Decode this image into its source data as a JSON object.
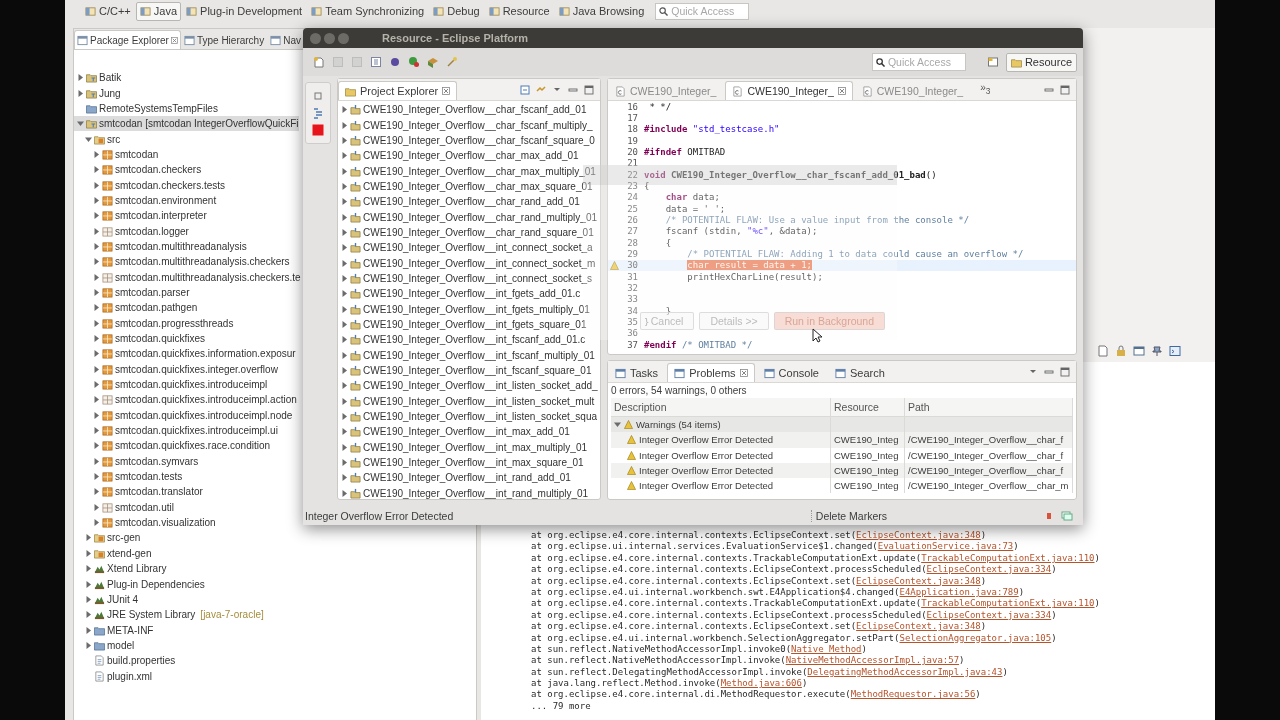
{
  "perspective_bar": {
    "perspectives": [
      {
        "label": "C/C++",
        "selected": false
      },
      {
        "label": "Java",
        "selected": true
      },
      {
        "label": "Plug-in Development",
        "selected": false
      },
      {
        "label": "Team Synchronizing",
        "selected": false
      },
      {
        "label": "Debug",
        "selected": false
      },
      {
        "label": "Resource",
        "selected": false
      },
      {
        "label": "Java Browsing",
        "selected": false
      }
    ],
    "quick_access": {
      "placeholder": "Quick Access"
    }
  },
  "package_explorer": {
    "tabs": [
      {
        "label": "Package Explorer",
        "selected": true
      },
      {
        "label": "Type Hierarchy",
        "selected": false
      },
      {
        "label": "Nav",
        "selected": false
      }
    ],
    "tree": [
      {
        "label": "Batik",
        "kind": "project",
        "expanded": false,
        "selected": false
      },
      {
        "label": "Jung",
        "kind": "project",
        "expanded": false,
        "selected": false
      },
      {
        "label": "RemoteSystemsTempFiles",
        "kind": "folder",
        "selected": false
      },
      {
        "label": "smtcodan [smtcodan IntegerOverflowQuickFi",
        "kind": "project",
        "expanded": true,
        "selected": true,
        "children": [
          {
            "label": "src",
            "kind": "source-folder",
            "expanded": true,
            "selected": false,
            "children": [
              {
                "label": "smtcodan",
                "kind": "package",
                "expanded": false,
                "selected": false
              },
              {
                "label": "smtcodan.checkers",
                "kind": "package",
                "expanded": false,
                "selected": false
              },
              {
                "label": "smtcodan.checkers.tests",
                "kind": "package",
                "expanded": false,
                "selected": false
              },
              {
                "label": "smtcodan.environment",
                "kind": "package",
                "expanded": false,
                "selected": false
              },
              {
                "label": "smtcodan.interpreter",
                "kind": "package",
                "expanded": false,
                "selected": false
              },
              {
                "label": "smtcodan.logger",
                "kind": "empty-package",
                "expanded": false,
                "selected": false
              },
              {
                "label": "smtcodan.multithreadanalysis",
                "kind": "package",
                "expanded": false,
                "selected": false
              },
              {
                "label": "smtcodan.multithreadanalysis.checkers",
                "kind": "package",
                "expanded": false,
                "selected": false
              },
              {
                "label": "smtcodan.multithreadanalysis.checkers.te",
                "kind": "empty-package",
                "expanded": false,
                "selected": false
              },
              {
                "label": "smtcodan.parser",
                "kind": "package",
                "expanded": false,
                "selected": false
              },
              {
                "label": "smtcodan.pathgen",
                "kind": "package",
                "expanded": false,
                "selected": false
              },
              {
                "label": "smtcodan.progressthreads",
                "kind": "package",
                "expanded": false,
                "selected": false
              },
              {
                "label": "smtcodan.quickfixes",
                "kind": "package",
                "expanded": false,
                "selected": false
              },
              {
                "label": "smtcodan.quickfixes.information.exposur",
                "kind": "package",
                "expanded": false,
                "selected": false
              },
              {
                "label": "smtcodan.quickfixes.integer.overflow",
                "kind": "package",
                "expanded": false,
                "selected": false
              },
              {
                "label": "smtcodan.quickfixes.introduceimpl",
                "kind": "package",
                "expanded": false,
                "selected": false
              },
              {
                "label": "smtcodan.quickfixes.introduceimpl.action",
                "kind": "empty-package",
                "expanded": false,
                "selected": false
              },
              {
                "label": "smtcodan.quickfixes.introduceimpl.node",
                "kind": "package",
                "expanded": false,
                "selected": false
              },
              {
                "label": "smtcodan.quickfixes.introduceimpl.ui",
                "kind": "package",
                "expanded": false,
                "selected": false
              },
              {
                "label": "smtcodan.quickfixes.race.condition",
                "kind": "package",
                "expanded": false,
                "selected": false
              },
              {
                "label": "smtcodan.symvars",
                "kind": "package",
                "expanded": false,
                "selected": false
              },
              {
                "label": "smtcodan.tests",
                "kind": "package",
                "expanded": false,
                "selected": false
              },
              {
                "label": "smtcodan.translator",
                "kind": "package",
                "expanded": false,
                "selected": false
              },
              {
                "label": "smtcodan.util",
                "kind": "empty-package",
                "expanded": false,
                "selected": false
              },
              {
                "label": "smtcodan.visualization",
                "kind": "package",
                "expanded": false,
                "selected": false
              }
            ]
          },
          {
            "label": "src-gen",
            "kind": "source-folder",
            "expanded": false,
            "selected": false
          },
          {
            "label": "xtend-gen",
            "kind": "source-folder",
            "expanded": false,
            "selected": false
          },
          {
            "label": "Xtend Library",
            "kind": "library",
            "expanded": false,
            "selected": false
          },
          {
            "label": "Plug-in Dependencies",
            "kind": "library",
            "expanded": false,
            "selected": false
          },
          {
            "label": "JUnit 4",
            "kind": "library",
            "expanded": false,
            "selected": false
          },
          {
            "label": "JRE System Library",
            "decoration": "[java-7-oracle]",
            "kind": "library",
            "expanded": false,
            "selected": false
          },
          {
            "label": "META-INF",
            "kind": "folder",
            "expanded": false,
            "selected": false
          },
          {
            "label": "model",
            "kind": "folder",
            "expanded": false,
            "selected": false
          },
          {
            "label": "build.properties",
            "kind": "file",
            "selected": false
          },
          {
            "label": "plugin.xml",
            "kind": "file",
            "selected": false
          }
        ]
      }
    ]
  },
  "console": {
    "lines": [
      {
        "text": "at org.eclipse.e4.core.internal.contexts.EclipseContext.set(",
        "link": "EclipseContext.java:348",
        "end": ")"
      },
      {
        "text": "at org.eclipse.ui.internal.services.EvaluationService$1.changed(",
        "link": "EvaluationService.java:73",
        "end": ")"
      },
      {
        "text": "at org.eclipse.e4.core.internal.contexts.TrackableComputationExt.update(",
        "link": "TrackableComputationExt.java:110",
        "end": ")"
      },
      {
        "text": "at org.eclipse.e4.core.internal.contexts.EclipseContext.processScheduled(",
        "link": "EclipseContext.java:334",
        "end": ")"
      },
      {
        "text": "at org.eclipse.e4.core.internal.contexts.EclipseContext.set(",
        "link": "EclipseContext.java:348",
        "end": ")"
      },
      {
        "text": "at org.eclipse.e4.ui.internal.workbench.swt.E4Application$4.changed(",
        "link": "E4Application.java:789",
        "end": ")"
      },
      {
        "text": "at org.eclipse.e4.core.internal.contexts.TrackableComputationExt.update(",
        "link": "TrackableComputationExt.java:110",
        "end": ")"
      },
      {
        "text": "at org.eclipse.e4.core.internal.contexts.EclipseContext.processScheduled(",
        "link": "EclipseContext.java:334",
        "end": ")"
      },
      {
        "text": "at org.eclipse.e4.core.internal.contexts.EclipseContext.set(",
        "link": "EclipseContext.java:348",
        "end": ")"
      },
      {
        "text": "at org.eclipse.e4.ui.internal.workbench.SelectionAggregator.setPart(",
        "link": "SelectionAggregator.java:105",
        "end": ")"
      },
      {
        "text": "at sun.reflect.NativeMethodAccessorImpl.invoke0(",
        "link": "Native Method",
        "end": ")"
      },
      {
        "text": "at sun.reflect.NativeMethodAccessorImpl.invoke(",
        "link": "NativeMethodAccessorImpl.java:57",
        "end": ")"
      },
      {
        "text": "at sun.reflect.DelegatingMethodAccessorImpl.invoke(",
        "link": "DelegatingMethodAccessorImpl.java:43",
        "end": ")"
      },
      {
        "text": "at java.lang.reflect.Method.invoke(",
        "link": "Method.java:606",
        "end": ")"
      },
      {
        "text": "at org.eclipse.e4.core.internal.di.MethodRequestor.execute(",
        "link": "MethodRequestor.java:56",
        "end": ")"
      },
      {
        "text": "... 79 more"
      }
    ]
  },
  "window": {
    "title": "Resource - Eclipse Platform",
    "quick_access": {
      "placeholder": "Quick Access"
    },
    "perspective": {
      "label": "Resource",
      "selected": true
    },
    "project_explorer": {
      "title": "Project Explorer",
      "items": [
        {
          "label": "CWE190_Integer_Overflow__char_fscanf_add_01",
          "selected": false
        },
        {
          "label": "CWE190_Integer_Overflow__char_fscanf_multiply_",
          "selected": false
        },
        {
          "label": "CWE190_Integer_Overflow__char_fscanf_square_0",
          "selected": false
        },
        {
          "label": "CWE190_Integer_Overflow__char_max_add_01",
          "selected": false
        },
        {
          "label": "CWE190_Integer_Overflow__char_max_multiply_01",
          "selected": false
        },
        {
          "label": "CWE190_Integer_Overflow__char_max_square_01",
          "selected": false
        },
        {
          "label": "CWE190_Integer_Overflow__char_rand_add_01",
          "selected": false
        },
        {
          "label": "CWE190_Integer_Overflow__char_rand_multiply_01",
          "selected": false
        },
        {
          "label": "CWE190_Integer_Overflow__char_rand_square_01",
          "selected": false
        },
        {
          "label": "CWE190_Integer_Overflow__int_connect_socket_a",
          "selected": false
        },
        {
          "label": "CWE190_Integer_Overflow__int_connect_socket_m",
          "selected": false
        },
        {
          "label": "CWE190_Integer_Overflow__int_connect_socket_s",
          "selected": false
        },
        {
          "label": "CWE190_Integer_Overflow__int_fgets_add_01.c",
          "selected": false
        },
        {
          "label": "CWE190_Integer_Overflow__int_fgets_multiply_01",
          "selected": false
        },
        {
          "label": "CWE190_Integer_Overflow__int_fgets_square_01",
          "selected": false
        },
        {
          "label": "CWE190_Integer_Overflow__int_fscanf_add_01.c",
          "selected": false
        },
        {
          "label": "CWE190_Integer_Overflow__int_fscanf_multiply_01",
          "selected": false
        },
        {
          "label": "CWE190_Integer_Overflow__int_fscanf_square_01",
          "selected": false
        },
        {
          "label": "CWE190_Integer_Overflow__int_listen_socket_add_",
          "selected": false
        },
        {
          "label": "CWE190_Integer_Overflow__int_listen_socket_mult",
          "selected": false
        },
        {
          "label": "CWE190_Integer_Overflow__int_listen_socket_squa",
          "selected": false
        },
        {
          "label": "CWE190_Integer_Overflow__int_max_add_01",
          "selected": false
        },
        {
          "label": "CWE190_Integer_Overflow__int_max_multiply_01",
          "selected": false
        },
        {
          "label": "CWE190_Integer_Overflow__int_max_square_01",
          "selected": false
        },
        {
          "label": "CWE190_Integer_Overflow__int_rand_add_01",
          "selected": false
        },
        {
          "label": "CWE190_Integer_Overflow__int_rand_multiply_01",
          "selected": false
        }
      ]
    },
    "editor": {
      "tabs": [
        {
          "label": "CWE190_Integer_",
          "selected": false
        },
        {
          "label": "CWE190_Integer_",
          "selected": true
        },
        {
          "label": "CWE190_Integer_",
          "selected": false
        }
      ],
      "more_tabs": "»$_{3}$",
      "lines": [
        {
          "number": "16",
          "segments": [
            {
              "kind": "plain",
              "text": " * */"
            }
          ]
        },
        {
          "number": "17"
        },
        {
          "number": "18",
          "segments": [
            {
              "kind": "keyword",
              "text": "#include"
            },
            {
              "kind": "string",
              "text": " \"std_testcase.h\""
            }
          ]
        },
        {
          "number": "19"
        },
        {
          "number": "20",
          "segments": [
            {
              "kind": "keyword",
              "text": "#ifndef"
            },
            {
              "kind": "plain",
              "text": " OMITBAD"
            }
          ]
        },
        {
          "number": "21"
        },
        {
          "number": "22",
          "segments": [
            {
              "kind": "keyword",
              "text": "void"
            },
            {
              "kind": "function",
              "text": " CWE190_Integer_Overflow__char_fscanf_add_01_bad"
            },
            {
              "kind": "plain",
              "text": "()"
            }
          ]
        },
        {
          "number": "23",
          "segments": [
            {
              "kind": "plain",
              "text": "{"
            }
          ]
        },
        {
          "number": "24",
          "segments": [
            {
              "kind": "keyword",
              "text": "    char"
            },
            {
              "kind": "plain",
              "text": " data;"
            }
          ]
        },
        {
          "number": "25",
          "segments": [
            {
              "kind": "plain",
              "text": "    data = ' ';"
            }
          ]
        },
        {
          "number": "26",
          "segments": [
            {
              "kind": "comment",
              "text": "    /* POTENTIAL FLAW: Use a value input from the console */"
            }
          ]
        },
        {
          "number": "27",
          "segments": [
            {
              "kind": "plain",
              "text": "    fscanf (stdin, "
            },
            {
              "kind": "string",
              "text": "\"%c\""
            },
            {
              "kind": "plain",
              "text": ", &data);"
            }
          ]
        },
        {
          "number": "28",
          "segments": [
            {
              "kind": "plain",
              "text": "    {"
            }
          ]
        },
        {
          "number": "29",
          "segments": [
            {
              "kind": "comment",
              "text": "        /* POTENTIAL FLAW: Adding 1 to data could cause an overflow */"
            }
          ]
        },
        {
          "number": "30",
          "warning": true,
          "current": true,
          "segments": [
            {
              "kind": "highlight",
              "text": "        char result = data + 1;"
            }
          ]
        },
        {
          "number": "31",
          "segments": [
            {
              "kind": "plain",
              "text": "        printHexCharLine(result);"
            }
          ]
        },
        {
          "number": "32"
        },
        {
          "number": "33"
        },
        {
          "number": "34",
          "segments": [
            {
              "kind": "plain",
              "text": "    }"
            }
          ]
        },
        {
          "number": "35",
          "segments": [
            {
              "kind": "plain",
              "text": "}"
            }
          ]
        },
        {
          "number": "36"
        },
        {
          "number": "37",
          "segments": [
            {
              "kind": "keyword",
              "text": "#endif"
            },
            {
              "kind": "comment",
              "text": " /* OMITBAD */"
            }
          ]
        }
      ]
    },
    "problems": {
      "tabs": [
        {
          "label": "Tasks",
          "selected": false
        },
        {
          "label": "Problems",
          "selected": true
        },
        {
          "label": "Console",
          "selected": false
        },
        {
          "label": "Search",
          "selected": false
        }
      ],
      "summary": "0 errors, 54 warnings, 0 others",
      "columns": [
        "Description",
        "Resource",
        "Path"
      ],
      "group": {
        "label": "Warnings (54 items)",
        "expanded": true
      },
      "rows": [
        {
          "description": "Integer Overflow Error Detected",
          "resource": "CWE190_Integ",
          "path": "/CWE190_Integer_Overflow__char_f",
          "selected": false
        },
        {
          "description": "Integer Overflow Error Detected",
          "resource": "CWE190_Integ",
          "path": "/CWE190_Integer_Overflow__char_f",
          "selected": false
        },
        {
          "description": "Integer Overflow Error Detected",
          "resource": "CWE190_Integ",
          "path": "/CWE190_Integer_Overflow__char_f",
          "selected": false
        },
        {
          "description": "Integer Overflow Error Detected",
          "resource": "CWE190_Integ",
          "path": "/CWE190_Integer_Overflow__char_m",
          "selected": false
        }
      ]
    },
    "status": {
      "message": "Integer Overflow Error Detected",
      "progress": "Delete Markers"
    },
    "progress_dialog": {
      "buttons": [
        {
          "label": "Cancel",
          "default": false
        },
        {
          "label": "Details >>",
          "default": false
        },
        {
          "label": "Run in Background",
          "default": true
        }
      ]
    }
  }
}
